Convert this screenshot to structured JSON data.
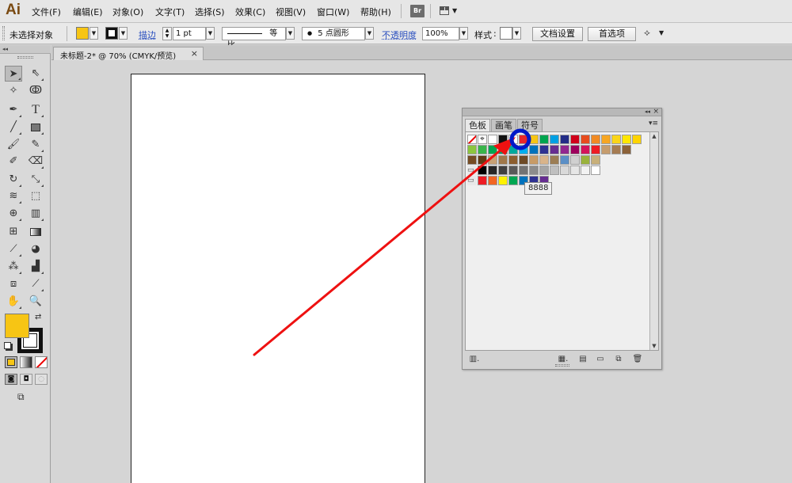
{
  "app": {
    "logo": "Ai"
  },
  "menu": {
    "items": [
      "文件(F)",
      "编辑(E)",
      "对象(O)",
      "文字(T)",
      "选择(S)",
      "效果(C)",
      "视图(V)",
      "窗口(W)",
      "帮助(H)"
    ],
    "bridge_label": "Br"
  },
  "control_bar": {
    "selection_status": "未选择对象",
    "stroke_label": "描边",
    "stroke_weight": "1 pt",
    "profile": "等比",
    "brush": "5 点圆形",
    "opacity_label": "不透明度",
    "opacity": "100%",
    "style_label": "样式",
    "doc_setup_button": "文档设置",
    "prefs_button": "首选项",
    "fill_color": "#f7c514"
  },
  "document": {
    "tab_title": "未标题-2* @ 70% (CMYK/预览)",
    "close_glyph": "×"
  },
  "tools": {
    "fill_color": "#f7c514",
    "stroke_color": "#111111"
  },
  "swatches_panel": {
    "collapse_glyph": "◂◂",
    "close_glyph": "×",
    "tabs": [
      "色板",
      "画笔",
      "符号"
    ],
    "tooltip": "8888",
    "row1": [
      "#ffffff",
      "#111111",
      "#ffffff",
      "#e8262a",
      "#f7c514",
      "#00a54f",
      "#00a0e3",
      "#232d87",
      "#d0021b",
      "#e74c1e",
      "#f08a24",
      "#f6a623",
      "#fad519",
      "#ffe600",
      "#ffd400"
    ],
    "row2": [
      "#8cc63f",
      "#39b54a",
      "#00a651",
      "#009e73",
      "#00a99d",
      "#00aeef",
      "#0072bc",
      "#2e3192",
      "#662d91",
      "#92278f",
      "#9e005d",
      "#d4145a",
      "#ed1c24",
      "#c69c6d",
      "#a67c52",
      "#8c6239"
    ],
    "row3": [
      "#754c24",
      "#603913",
      "#c7a175",
      "#a0784a",
      "#8c5e2f",
      "#6d4a26",
      "#c79b67",
      "#d9b48a",
      "#9c7d54",
      "#5b8fc6",
      "#d0d0d0",
      "#9ab23c",
      "#c8b07a"
    ],
    "row4": [
      "#000000",
      "#262626",
      "#404040",
      "#595959",
      "#737373",
      "#8c8c8c",
      "#a6a6a6",
      "#bfbfbf",
      "#d9d9d9",
      "#e6e6e6",
      "#f2f2f2",
      "#ffffff"
    ],
    "row5": [
      "#ed1c24",
      "#f26522",
      "#fff200",
      "#00a651",
      "#0072bc",
      "#2e3192",
      "#662d91"
    ]
  },
  "annotation": {
    "arrow_color": "#ee1111",
    "circle_color": "#0018c8"
  }
}
